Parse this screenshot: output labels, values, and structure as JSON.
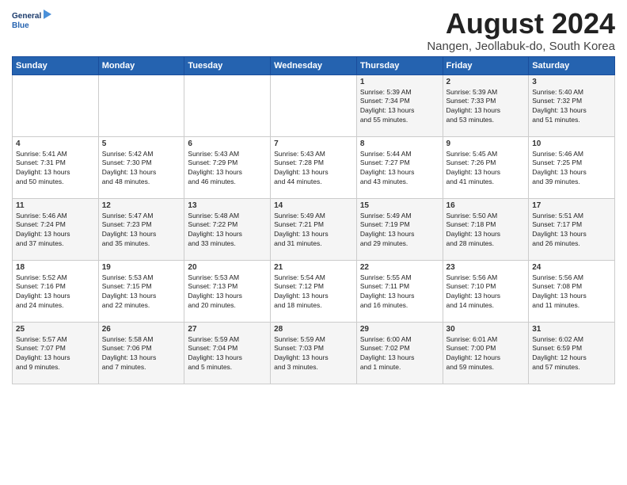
{
  "header": {
    "logo_line1": "General",
    "logo_line2": "Blue",
    "title": "August 2024",
    "subtitle": "Nangen, Jeollabuk-do, South Korea"
  },
  "days_of_week": [
    "Sunday",
    "Monday",
    "Tuesday",
    "Wednesday",
    "Thursday",
    "Friday",
    "Saturday"
  ],
  "weeks": [
    [
      {
        "day": "",
        "info": ""
      },
      {
        "day": "",
        "info": ""
      },
      {
        "day": "",
        "info": ""
      },
      {
        "day": "",
        "info": ""
      },
      {
        "day": "1",
        "info": "Sunrise: 5:39 AM\nSunset: 7:34 PM\nDaylight: 13 hours\nand 55 minutes."
      },
      {
        "day": "2",
        "info": "Sunrise: 5:39 AM\nSunset: 7:33 PM\nDaylight: 13 hours\nand 53 minutes."
      },
      {
        "day": "3",
        "info": "Sunrise: 5:40 AM\nSunset: 7:32 PM\nDaylight: 13 hours\nand 51 minutes."
      }
    ],
    [
      {
        "day": "4",
        "info": "Sunrise: 5:41 AM\nSunset: 7:31 PM\nDaylight: 13 hours\nand 50 minutes."
      },
      {
        "day": "5",
        "info": "Sunrise: 5:42 AM\nSunset: 7:30 PM\nDaylight: 13 hours\nand 48 minutes."
      },
      {
        "day": "6",
        "info": "Sunrise: 5:43 AM\nSunset: 7:29 PM\nDaylight: 13 hours\nand 46 minutes."
      },
      {
        "day": "7",
        "info": "Sunrise: 5:43 AM\nSunset: 7:28 PM\nDaylight: 13 hours\nand 44 minutes."
      },
      {
        "day": "8",
        "info": "Sunrise: 5:44 AM\nSunset: 7:27 PM\nDaylight: 13 hours\nand 43 minutes."
      },
      {
        "day": "9",
        "info": "Sunrise: 5:45 AM\nSunset: 7:26 PM\nDaylight: 13 hours\nand 41 minutes."
      },
      {
        "day": "10",
        "info": "Sunrise: 5:46 AM\nSunset: 7:25 PM\nDaylight: 13 hours\nand 39 minutes."
      }
    ],
    [
      {
        "day": "11",
        "info": "Sunrise: 5:46 AM\nSunset: 7:24 PM\nDaylight: 13 hours\nand 37 minutes."
      },
      {
        "day": "12",
        "info": "Sunrise: 5:47 AM\nSunset: 7:23 PM\nDaylight: 13 hours\nand 35 minutes."
      },
      {
        "day": "13",
        "info": "Sunrise: 5:48 AM\nSunset: 7:22 PM\nDaylight: 13 hours\nand 33 minutes."
      },
      {
        "day": "14",
        "info": "Sunrise: 5:49 AM\nSunset: 7:21 PM\nDaylight: 13 hours\nand 31 minutes."
      },
      {
        "day": "15",
        "info": "Sunrise: 5:49 AM\nSunset: 7:19 PM\nDaylight: 13 hours\nand 29 minutes."
      },
      {
        "day": "16",
        "info": "Sunrise: 5:50 AM\nSunset: 7:18 PM\nDaylight: 13 hours\nand 28 minutes."
      },
      {
        "day": "17",
        "info": "Sunrise: 5:51 AM\nSunset: 7:17 PM\nDaylight: 13 hours\nand 26 minutes."
      }
    ],
    [
      {
        "day": "18",
        "info": "Sunrise: 5:52 AM\nSunset: 7:16 PM\nDaylight: 13 hours\nand 24 minutes."
      },
      {
        "day": "19",
        "info": "Sunrise: 5:53 AM\nSunset: 7:15 PM\nDaylight: 13 hours\nand 22 minutes."
      },
      {
        "day": "20",
        "info": "Sunrise: 5:53 AM\nSunset: 7:13 PM\nDaylight: 13 hours\nand 20 minutes."
      },
      {
        "day": "21",
        "info": "Sunrise: 5:54 AM\nSunset: 7:12 PM\nDaylight: 13 hours\nand 18 minutes."
      },
      {
        "day": "22",
        "info": "Sunrise: 5:55 AM\nSunset: 7:11 PM\nDaylight: 13 hours\nand 16 minutes."
      },
      {
        "day": "23",
        "info": "Sunrise: 5:56 AM\nSunset: 7:10 PM\nDaylight: 13 hours\nand 14 minutes."
      },
      {
        "day": "24",
        "info": "Sunrise: 5:56 AM\nSunset: 7:08 PM\nDaylight: 13 hours\nand 11 minutes."
      }
    ],
    [
      {
        "day": "25",
        "info": "Sunrise: 5:57 AM\nSunset: 7:07 PM\nDaylight: 13 hours\nand 9 minutes."
      },
      {
        "day": "26",
        "info": "Sunrise: 5:58 AM\nSunset: 7:06 PM\nDaylight: 13 hours\nand 7 minutes."
      },
      {
        "day": "27",
        "info": "Sunrise: 5:59 AM\nSunset: 7:04 PM\nDaylight: 13 hours\nand 5 minutes."
      },
      {
        "day": "28",
        "info": "Sunrise: 5:59 AM\nSunset: 7:03 PM\nDaylight: 13 hours\nand 3 minutes."
      },
      {
        "day": "29",
        "info": "Sunrise: 6:00 AM\nSunset: 7:02 PM\nDaylight: 13 hours\nand 1 minute."
      },
      {
        "day": "30",
        "info": "Sunrise: 6:01 AM\nSunset: 7:00 PM\nDaylight: 12 hours\nand 59 minutes."
      },
      {
        "day": "31",
        "info": "Sunrise: 6:02 AM\nSunset: 6:59 PM\nDaylight: 12 hours\nand 57 minutes."
      }
    ]
  ]
}
